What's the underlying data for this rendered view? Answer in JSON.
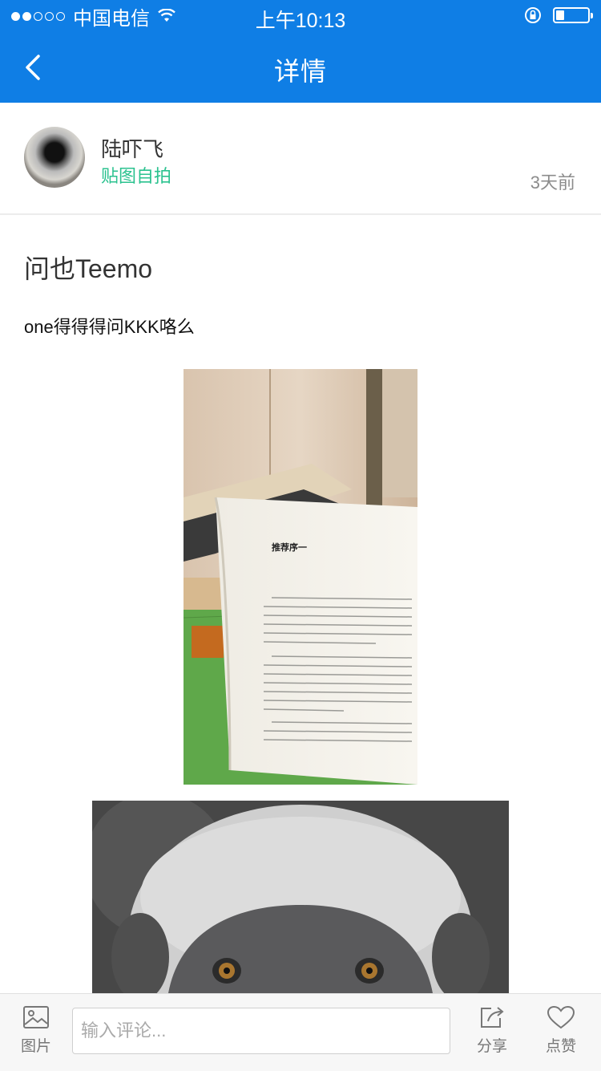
{
  "status_bar": {
    "carrier": "中国电信",
    "time": "上午10:13",
    "signal_bars_filled": 2,
    "signal_bars_total": 5,
    "battery_level": 0.25
  },
  "nav": {
    "title": "详情"
  },
  "author": {
    "name": "陆吓飞",
    "tag": "贴图自拍",
    "time": "3天前"
  },
  "post": {
    "title": "问也Teemo",
    "body": "one得得得问KKK咯么",
    "photos": [
      "book-photo",
      "lemur-photo"
    ]
  },
  "book_photo": {
    "heading": "推荐序一"
  },
  "bottom_bar": {
    "image_label": "图片",
    "comment_placeholder": "输入评论...",
    "share_label": "分享",
    "like_label": "点赞"
  },
  "colors": {
    "accent": "#0f7ee5",
    "tag_green": "#2bc28f"
  }
}
